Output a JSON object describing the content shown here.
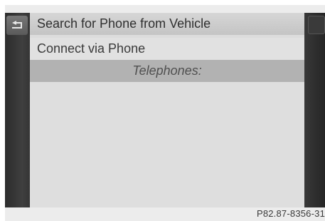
{
  "menu": {
    "items": [
      {
        "label": "Search for Phone from Vehicle",
        "selected": true
      },
      {
        "label": "Connect via Phone"
      }
    ],
    "section_header": "Telephones:"
  },
  "icons": {
    "back": "back-arrow-icon"
  },
  "figure_code": "P82.87-8356-31",
  "colors": {
    "screen_background": "#dcdcdc",
    "selected_row": "#c8c8c8",
    "header_bar": "#b2b2b2",
    "side_rails": "#333333"
  }
}
